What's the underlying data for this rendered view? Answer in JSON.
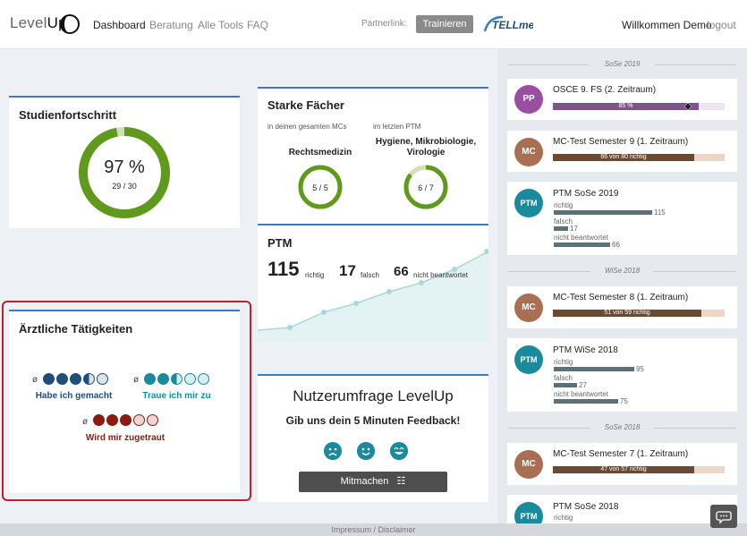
{
  "header": {
    "logo_text_light": "Level",
    "logo_text_dark": "Up",
    "nav": [
      "Dashboard",
      "Beratung",
      "Alle Tools",
      "FAQ"
    ],
    "partner_label": "Partnerlink:",
    "partner_button": "Trainieren",
    "partner_logo": "TELLme",
    "welcome": "Willkommen Demo",
    "logout": "logout"
  },
  "studienfortschritt": {
    "title": "Studienfortschritt",
    "percent_label": "97 %",
    "count_label": "29 / 30",
    "progress": 0.97
  },
  "starke": {
    "title": "Starke Fächer",
    "col1_label": "in deinen gesamten MCs",
    "col2_label": "im letzten PTM",
    "col1_subject": "Rechtsmedizin",
    "col2_subject_line1": "Hygiene, Mikrobiologie,",
    "col2_subject_line2": "Virologie",
    "col1_value": "5 / 5",
    "col2_value": "6 / 7",
    "col1_progress": 1.0,
    "col2_progress": 0.857
  },
  "ptm": {
    "title": "PTM",
    "richtig_num": "115",
    "richtig_label": "richtig",
    "falsch_num": "17",
    "falsch_label": "falsch",
    "nb_num": "66",
    "nb_label": "nicht beantwortet"
  },
  "aerztlich": {
    "title": "Ärztliche Tätigkeiten",
    "diam": "ø",
    "caption1": "Habe ich gemacht",
    "caption2": "Traue ich mir zu",
    "caption3": "Wird mir zugetraut",
    "rating1": 3.5,
    "rating2": 2.5,
    "rating3": 3,
    "colors": {
      "blue": "#1f4e79",
      "teal": "#1a8b9c",
      "red": "#8b1a10"
    }
  },
  "survey": {
    "title": "Nutzerumfrage LevelUp",
    "subtitle": "Gib uns dein 5 Minuten Feedback!",
    "button": "Mitmachen"
  },
  "exams": {
    "sem1": "SoSe 2019",
    "sem2": "WiSe 2018",
    "sem3": "SoSe 2018",
    "osce": {
      "badge": "PP",
      "title": "OSCE 9. FS (2. Zeitraum)",
      "bar_text": "85 %",
      "fill": 0.85,
      "color": "#7e5389"
    },
    "mc9": {
      "badge": "MC",
      "title": "MC-Test Semester 9 (1. Zeitraum)",
      "bar_text": "66 von 80 richtig",
      "fill": 0.825,
      "color": "#6b4a33"
    },
    "ptm19": {
      "badge": "PTM",
      "title": "PTM SoSe 2019",
      "richtig": "richtig",
      "falsch": "falsch",
      "nb": "nicht beantwortet",
      "v1": "115",
      "v2": "17",
      "v3": "66"
    },
    "mc8": {
      "badge": "MC",
      "title": "MC-Test Semester 8 (1. Zeitraum)",
      "bar_text": "51 von 59 richtig",
      "fill": 0.864,
      "color": "#6b4a33"
    },
    "ptm18w": {
      "badge": "PTM",
      "title": "PTM WiSe 2018",
      "richtig": "richtig",
      "falsch": "falsch",
      "nb": "nicht beantwortet",
      "v1": "95",
      "v2": "27",
      "v3": "75"
    },
    "mc7": {
      "badge": "MC",
      "title": "MC-Test Semester 7 (1. Zeitraum)",
      "bar_text": "47 von 57 richtig",
      "fill": 0.825,
      "color": "#6b4a33"
    },
    "ptm18s": {
      "badge": "PTM",
      "title": "PTM SoSe 2018",
      "richtig": "richtig"
    }
  },
  "footer": "Impressum / Disclaimer"
}
